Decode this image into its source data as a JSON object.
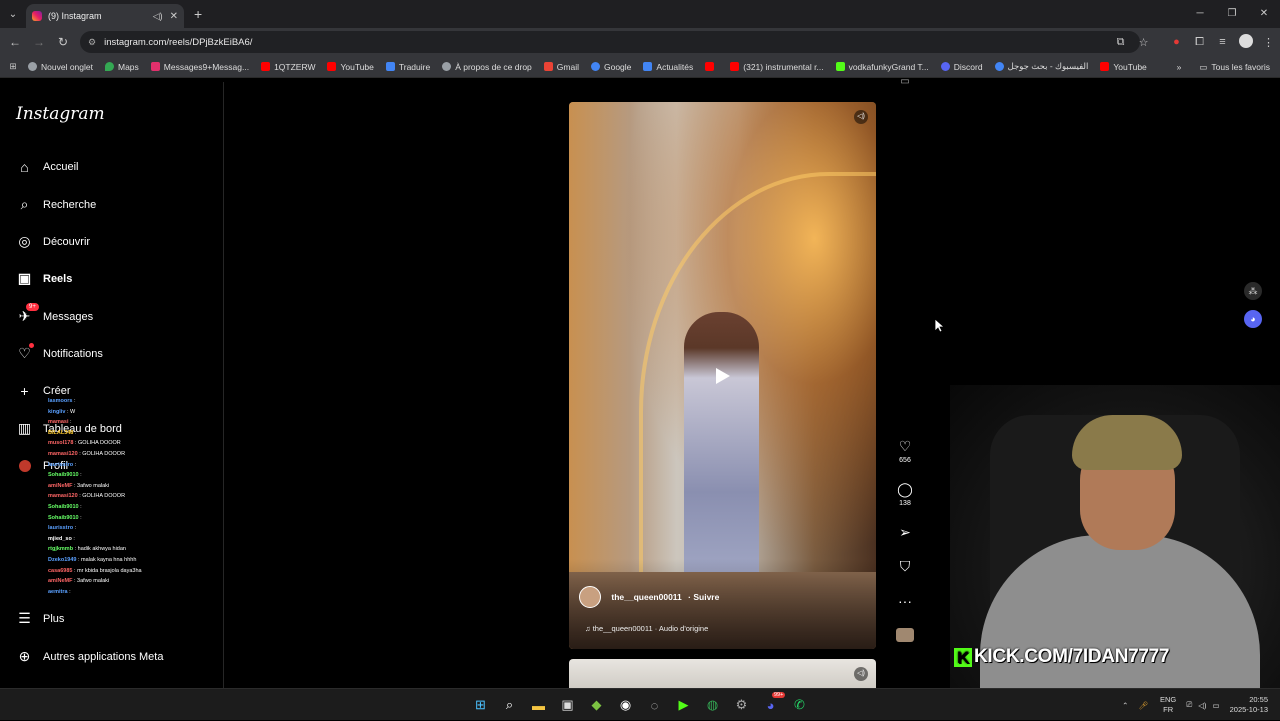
{
  "browser": {
    "tab_title": "(9) Instagram",
    "url": "instagram.com/reels/DPjBzkEiBA6/",
    "bookmarks": [
      "Nouvel onglet",
      "Maps",
      "Messages9+Messag...",
      "1QTZERW",
      "YouTube",
      "Traduire",
      "À propos de ce drop",
      "Gmail",
      "Google",
      "Actualités",
      "(321) instrumental r...",
      "vodkafunkyGrand T...",
      "Discord",
      "الفيسبوك - بحث جوجل",
      "YouTube"
    ],
    "all_bookmarks": "Tous les favoris"
  },
  "instagram": {
    "logo": "Instagram",
    "nav": [
      "Accueil",
      "Recherche",
      "Découvrir",
      "Reels",
      "Messages",
      "Notifications",
      "Créer",
      "Tableau de bord",
      "Profil",
      "Plus",
      "Autres applications Meta"
    ],
    "messages_badge": "9+",
    "reel": {
      "username": "the__queen00011",
      "follow": "Suivre",
      "audio": "the__queen00011 · Audio d'origine",
      "likes": "656",
      "comments": "138"
    }
  },
  "chat": [
    {
      "user": "lasmoors",
      "msg": "",
      "color": "#5aa0ff"
    },
    {
      "user": "kingliv",
      "msg": "W",
      "color": "#5aa0ff"
    },
    {
      "user": "mamasi",
      "msg": "",
      "color": "#ff6666"
    },
    {
      "user": "BILAL348",
      "msg": "",
      "color": "#ffcc33"
    },
    {
      "user": "musol178",
      "msg": "GOLIHA DOOOR",
      "color": "#ff6666"
    },
    {
      "user": "mamasi120",
      "msg": "GOLIHA DOOOR",
      "color": "#ff6666"
    },
    {
      "user": "laurisstro",
      "msg": "",
      "color": "#5aa0ff"
    },
    {
      "user": "Sohaib9010",
      "msg": "",
      "color": "#66ff66"
    },
    {
      "user": "amiNeMF",
      "msg": "3afwo malaki",
      "color": "#ff6666"
    },
    {
      "user": "mamasi120",
      "msg": "GOLIHA DOOOR",
      "color": "#ff6666"
    },
    {
      "user": "Sohaib9010",
      "msg": "",
      "color": "#66ff66"
    },
    {
      "user": "Sohaib9010",
      "msg": "",
      "color": "#66ff66"
    },
    {
      "user": "laurisstro",
      "msg": "",
      "color": "#5aa0ff"
    },
    {
      "user": "mjied_so",
      "msg": "",
      "color": "#ffffff"
    },
    {
      "user": "rtgjkmmb",
      "msg": "hadik akhwya hidan",
      "color": "#66ff66"
    },
    {
      "user": "Dzeko1949",
      "msg": "malak kayna hna hhhh",
      "color": "#5aa0ff"
    },
    {
      "user": "casa6985",
      "msg": "mr kbida brasjola daya3ha",
      "color": "#ff6666"
    },
    {
      "user": "amiNeMF",
      "msg": "3afwo malaki",
      "color": "#ff6666"
    },
    {
      "user": "aemitra",
      "msg": "",
      "color": "#5aa0ff"
    }
  ],
  "stream": {
    "overlay": "KICK.COM/7IDAN7777"
  },
  "taskbar": {
    "lang1": "ENG",
    "lang2": "FR",
    "time": "20:55",
    "date": "2025-10-13",
    "badge": "99+"
  }
}
